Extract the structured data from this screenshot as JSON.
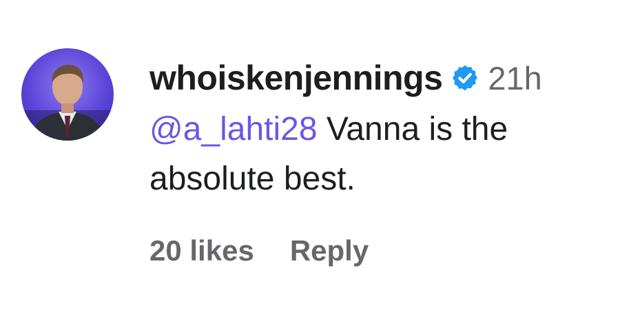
{
  "comment": {
    "username": "whoiskenjennings",
    "timestamp": "21h",
    "mention": "@a_lahti28",
    "text": " Vanna is the absolute best.",
    "likes_label": "20 likes",
    "reply_label": "Reply"
  },
  "icons": {
    "avatar": "avatar-portrait",
    "verified": "verified-badge-icon"
  },
  "colors": {
    "mention": "#6a57e6",
    "verified": "#1d9bf0",
    "muted": "#65676b",
    "text": "#1c1e21"
  }
}
